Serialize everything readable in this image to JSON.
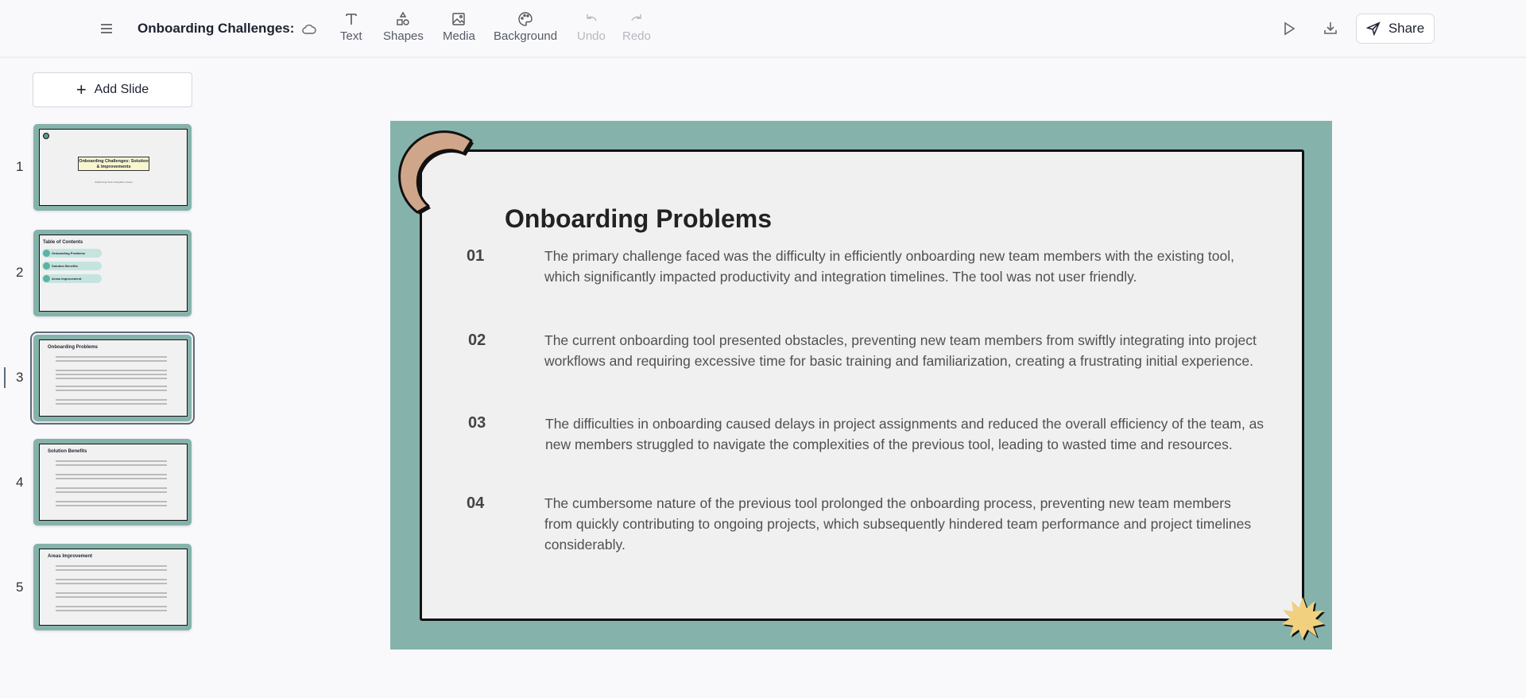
{
  "header": {
    "title": "Onboarding Challenges:",
    "tools": [
      {
        "label": "Text",
        "icon": "text-icon"
      },
      {
        "label": "Shapes",
        "icon": "shapes-icon"
      },
      {
        "label": "Media",
        "icon": "image-icon"
      },
      {
        "label": "Background",
        "icon": "palette-icon"
      },
      {
        "label": "Undo",
        "icon": "undo-icon"
      },
      {
        "label": "Redo",
        "icon": "redo-icon"
      }
    ],
    "share_label": "Share"
  },
  "sidebar": {
    "add_slide_label": "Add Slide",
    "slides": [
      {
        "number": "1",
        "title": "Onboarding Challenges: Solution & Improvements",
        "subtitle": "Addressing Team Integration Issues"
      },
      {
        "number": "2",
        "title": "Table of Contents",
        "items": [
          "Onboarding Problems",
          "Solution Benefits",
          "Areas Improvement"
        ]
      },
      {
        "number": "3",
        "title": "Onboarding Problems"
      },
      {
        "number": "4",
        "title": "Solution Benefits"
      },
      {
        "number": "5",
        "title": "Areas Improvement"
      }
    ],
    "active_slide": 3
  },
  "slide": {
    "title": "Onboarding Problems",
    "items": [
      {
        "num": "01",
        "text": "The primary challenge faced was the difficulty in efficiently onboarding new team members with the existing tool, which significantly impacted productivity and integration timelines. The tool was not user friendly."
      },
      {
        "num": "02",
        "text": "The current onboarding tool presented obstacles, preventing new team members from swiftly integrating into project workflows and requiring excessive time for basic training and familiarization, creating a frustrating initial experience."
      },
      {
        "num": "03",
        "text": "The difficulties in onboarding caused delays in project assignments and reduced the overall efficiency of the team, as new members struggled to navigate the complexities of the previous tool, leading to wasted time and resources."
      },
      {
        "num": "04",
        "text": "The cumbersome nature of the previous tool prolonged the onboarding process, preventing new team members from quickly contributing to ongoing projects, which subsequently hindered team performance and project timelines considerably."
      }
    ],
    "colors": {
      "background": "#85b3ab",
      "panel": "#f0f0f0",
      "arc": "#d0a68a",
      "star": "#f1d17f"
    }
  }
}
